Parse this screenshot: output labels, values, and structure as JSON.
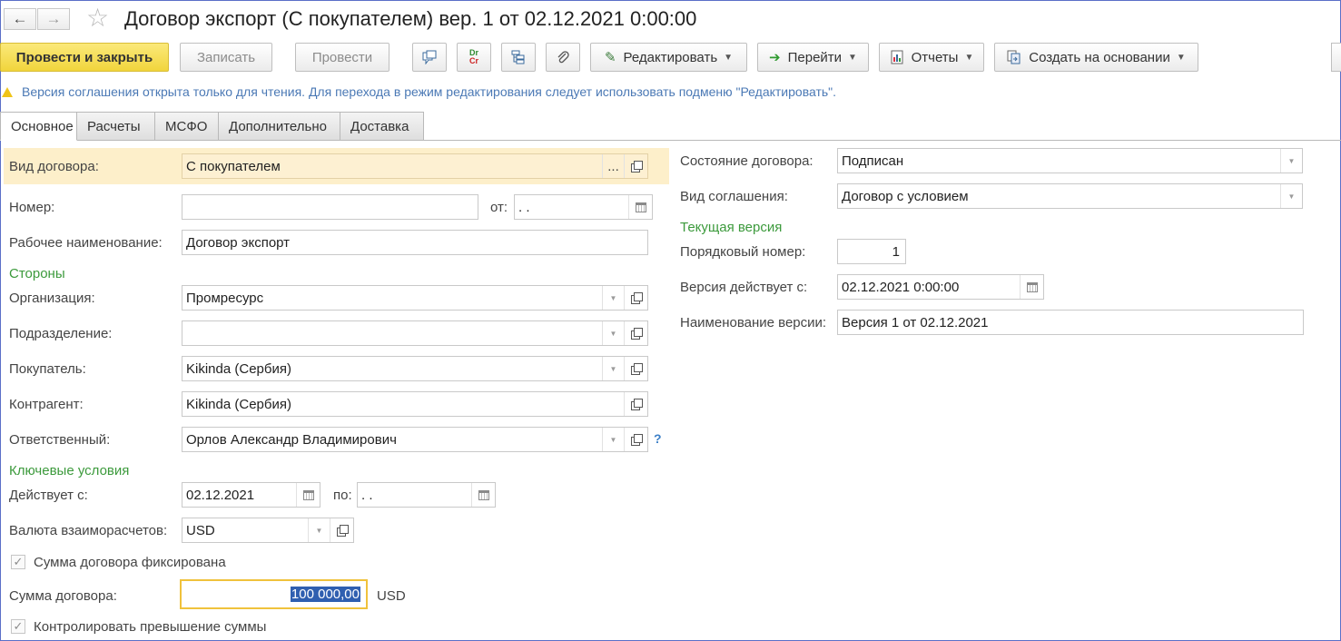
{
  "window": {
    "title": "Договор экспорт (С покупателем) вер. 1 от 02.12.2021 0:00:00"
  },
  "toolbar": {
    "post_close": "Провести и закрыть",
    "save": "Записать",
    "post": "Провести",
    "edit": "Редактировать",
    "goto": "Перейти",
    "reports": "Отчеты",
    "create_based": "Создать на основании",
    "drcr_top": "Dr",
    "drcr_bottom": "Cr"
  },
  "info": {
    "message": "Версия соглашения открыта только для чтения. Для перехода в режим редактирования следует использовать подменю \"Редактировать\"."
  },
  "tabs": [
    {
      "label": "Основное",
      "active": true
    },
    {
      "label": "Расчеты",
      "active": false
    },
    {
      "label": "МСФО",
      "active": false
    },
    {
      "label": "Дополнительно",
      "active": false
    },
    {
      "label": "Доставка",
      "active": false
    }
  ],
  "left": {
    "contract_type_label": "Вид договора:",
    "contract_type_value": "С покупателем",
    "number_label": "Номер:",
    "number_value": "",
    "from_label": "от:",
    "from_value": " .  .",
    "work_name_label": "Рабочее наименование:",
    "work_name_value": "Договор экспорт",
    "parties_group": "Стороны",
    "org_label": "Организация:",
    "org_value": "Промресурс",
    "dept_label": "Подразделение:",
    "dept_value": "",
    "buyer_label": "Покупатель:",
    "buyer_value": "Kikinda (Сербия)",
    "counterparty_label": "Контрагент:",
    "counterparty_value": "Kikinda (Сербия)",
    "responsible_label": "Ответственный:",
    "responsible_value": "Орлов Александр Владимирович",
    "help_mark": "?",
    "key_terms_group": "Ключевые условия",
    "valid_from_label": "Действует с:",
    "valid_from_value": "02.12.2021",
    "valid_to_label": "по:",
    "valid_to_value": " .  .",
    "currency_label": "Валюта взаиморасчетов:",
    "currency_value": "USD",
    "fixed_sum_label": "Сумма договора фиксирована",
    "fixed_sum_checked": true,
    "sum_label": "Сумма договора:",
    "sum_value": "100 000,00",
    "sum_currency": "USD",
    "control_excess_label": "Контролировать превышение суммы",
    "control_excess_checked": true
  },
  "right": {
    "state_label": "Состояние договора:",
    "state_value": "Подписан",
    "agreement_type_label": "Вид соглашения:",
    "agreement_type_value": "Договор с условием",
    "current_version_group": "Текущая версия",
    "seq_label": "Порядковый номер:",
    "seq_value": "1",
    "version_from_label": "Версия действует с:",
    "version_from_value": "02.12.2021  0:00:00",
    "version_name_label": "Наименование версии:",
    "version_name_value": "Версия 1 от 02.12.2021"
  },
  "icons": {
    "checkmark": "✓",
    "dropdown": "▼",
    "dots": "...",
    "back": "🡐",
    "forward": "🡒",
    "star": "☆"
  },
  "colors": {
    "primary_button": "#f1d53c",
    "group_heading": "#3c9a3c",
    "info_text": "#4b79b5",
    "highlight_row": "#fdefca",
    "focus_border": "#f0c23c"
  }
}
